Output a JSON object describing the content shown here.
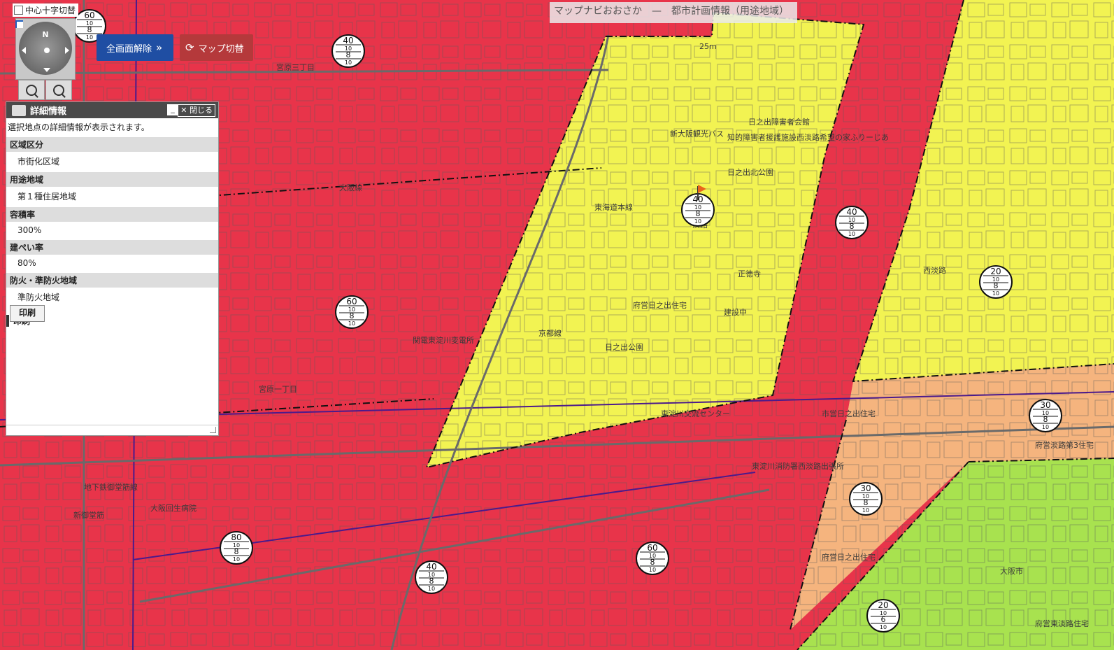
{
  "header": {
    "title": "マップナビおおさか　—　都市計画情報（用途地域）"
  },
  "controls": {
    "center_cross_label": "中心十字切替",
    "compass_north": "N",
    "fullscreen_label": "全画面解除",
    "map_switch_label": "マップ切替"
  },
  "detail_panel": {
    "title": "詳細情報",
    "close_label": "閉じる",
    "minimize_label": "_",
    "description": "選択地点の詳細情報が表示されます。",
    "fields": [
      {
        "label": "区域区分",
        "value": "市街化区域"
      },
      {
        "label": "用途地域",
        "value": "第１種住居地域"
      },
      {
        "label": "容積率",
        "value": "300%"
      },
      {
        "label": "建ぺい率",
        "value": "80%"
      },
      {
        "label": "防火・準防火地域",
        "value": "準防火地域"
      }
    ],
    "print_section": "印刷",
    "print_button": "印刷"
  },
  "map": {
    "colors": {
      "commercial": "#e8344a",
      "residential_1": "#f2f352",
      "quasi_industrial": "#f5b47e",
      "low_residential": "#a8e24f",
      "linework": "#5a5a5a",
      "rail": "#4b1a8c"
    },
    "labels": [
      "宮原三丁目",
      "宮原一丁目",
      "大阪線",
      "新大阪観光バス",
      "日之出障害者会館",
      "知的障害者援護施設西淡路希望の家ふりーじあ",
      "日之出北公園",
      "東海道本線",
      "淡路",
      "正徳寺",
      "府営日之出住宅",
      "建設中",
      "日之出公園",
      "京都線",
      "東淀川交流センター",
      "関電東淀川変電所",
      "大阪回生病院",
      "新御堂筋",
      "地下鉄御堂筋線",
      "市営日之出住宅",
      "西淡路",
      "府営淡路第3住宅",
      "東淀川消防署西淡路出張所",
      "府営日之出住宅",
      "大阪市",
      "府営東淡路住宅",
      "25m"
    ],
    "zone_markers": [
      {
        "far": "60",
        "a": "10",
        "b": "8",
        "c": "10"
      },
      {
        "far": "40",
        "a": "10",
        "b": "8",
        "c": "10"
      },
      {
        "far": "40",
        "a": "10",
        "b": "8",
        "c": "10"
      },
      {
        "far": "60",
        "a": "10",
        "b": "8",
        "c": "10"
      },
      {
        "far": "40",
        "a": "10",
        "b": "8",
        "c": "10"
      },
      {
        "far": "20",
        "a": "10",
        "b": "8",
        "c": "10"
      },
      {
        "far": "30",
        "a": "10",
        "b": "8",
        "c": "10"
      },
      {
        "far": "30",
        "a": "10",
        "b": "8",
        "c": "10"
      },
      {
        "far": "80",
        "a": "10",
        "b": "8",
        "c": "10"
      },
      {
        "far": "40",
        "a": "10",
        "b": "8",
        "c": "10"
      },
      {
        "far": "60",
        "a": "10",
        "b": "8",
        "c": "10"
      },
      {
        "far": "20",
        "a": "10",
        "b": "6",
        "c": "10"
      }
    ]
  }
}
